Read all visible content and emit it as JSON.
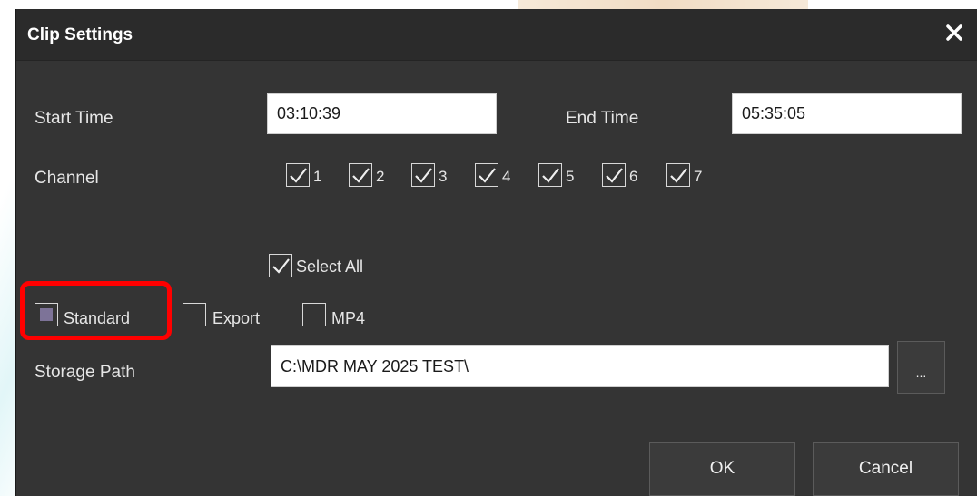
{
  "dialog": {
    "title": "Clip Settings",
    "close_icon": "close-icon"
  },
  "time": {
    "start_label": "Start Time",
    "start_value": "03:10:39",
    "end_label": "End Time",
    "end_value": "05:35:05"
  },
  "channel": {
    "label": "Channel",
    "items": [
      {
        "number": "1",
        "checked": true
      },
      {
        "number": "2",
        "checked": true
      },
      {
        "number": "3",
        "checked": true
      },
      {
        "number": "4",
        "checked": true
      },
      {
        "number": "5",
        "checked": true
      },
      {
        "number": "6",
        "checked": true
      },
      {
        "number": "7",
        "checked": true
      }
    ],
    "select_all_label": "Select All",
    "select_all_checked": true
  },
  "format": {
    "options": [
      {
        "label": "Standard",
        "selected": true
      },
      {
        "label": "Export",
        "selected": false
      },
      {
        "label": "MP4",
        "selected": false
      }
    ],
    "highlight_color": "#ff0000"
  },
  "storage": {
    "label": "Storage Path",
    "value": "C:\\MDR MAY 2025 TEST\\",
    "browse_label": "..."
  },
  "actions": {
    "ok_label": "OK",
    "cancel_label": "Cancel"
  },
  "colors": {
    "dialog_bg": "#343434",
    "titlebar_bg": "#2b2b2b",
    "selected_indicator": "#7d7398"
  }
}
